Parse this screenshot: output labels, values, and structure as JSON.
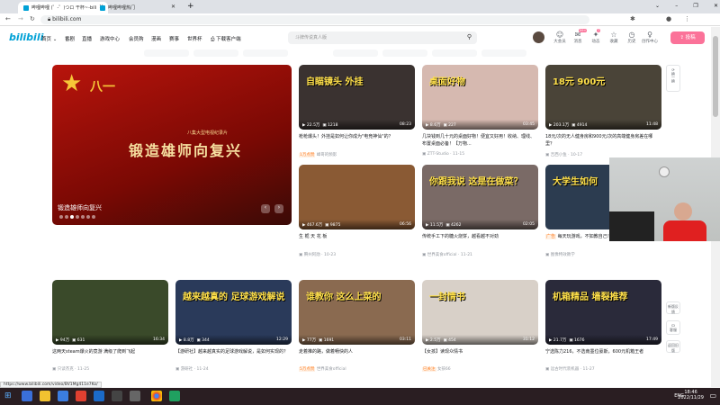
{
  "browser": {
    "tabs": [
      {
        "label": "哔哩哔哩 (゜-゜)つロ 干杯~-bili"
      },
      {
        "label": "哔哩哔哩热门"
      }
    ],
    "new_tab": "+",
    "url": "bilibili.com",
    "window_controls": [
      "⌄",
      "–",
      "❐",
      "✕"
    ]
  },
  "header": {
    "logo": "bilibili",
    "nav": [
      "首页",
      "番剧",
      "直播",
      "游戏中心",
      "会员购",
      "漫画",
      "赛事",
      "世界杯",
      "下载客户端"
    ],
    "search_placeholder": "斗牌传说真人版",
    "icons": [
      {
        "label": "大会员",
        "icon": "☺"
      },
      {
        "label": "消息",
        "icon": "✉",
        "badge": "99+"
      },
      {
        "label": "动态",
        "icon": "✦",
        "badge": "7"
      },
      {
        "label": "收藏",
        "icon": "☆"
      },
      {
        "label": "历史",
        "icon": "◷"
      },
      {
        "label": "创作中心",
        "icon": "♀"
      }
    ],
    "upload": "⇪ 投稿"
  },
  "banner": {
    "headline": "锻造雄师向复兴",
    "badge": "八一",
    "caption": "锻造雄师向复兴",
    "subtitle": "八集大型电视纪录片",
    "slides": 7,
    "active_slide": 2
  },
  "cards": [
    {
      "stats": "22.5万",
      "danmaku": "1218",
      "duration": "08:23",
      "title": "枪枪爆头！外挂是如何让你成为\"电竞神仙\"的？",
      "tag": "1万点赞",
      "author": "峰哥的频影",
      "date": "",
      "overlay": "自瞄镜头 外挂",
      "color": "#3a3230"
    },
    {
      "stats": "8.6万",
      "danmaku": "227",
      "duration": "03:45",
      "title": "几块钱到几十元的桌面好物！便宜又好用！收纳、理线、布置桌面必备！【万物...",
      "tag": "",
      "author": "ZTT-Studio",
      "date": "11-15",
      "overlay": "桌面好物",
      "color": "#d6b9b0"
    },
    {
      "stats": "203.1万",
      "danmaku": "4914",
      "duration": "11:48",
      "title": "18元/次的无人健身房和900元/次的高端健身房差在哪里？",
      "tag": "",
      "author": "吉西小鱼",
      "date": "10-17",
      "overlay": "18元 900元",
      "color": "#4a4438"
    },
    {
      "stats": "467.6万",
      "danmaku": "9875",
      "duration": "06:56",
      "title": "生 栀 天 花 板",
      "tag": "",
      "author": "腾州阿勋",
      "date": "10-23",
      "overlay": "",
      "color": "#8a5a34"
    },
    {
      "stats": "11.5万",
      "danmaku": "4262",
      "duration": "02:05",
      "title": "传统手工下的糖火烧饼，越看越不对劲",
      "tag": "",
      "author": "世界美食official",
      "date": "11-21",
      "overlay": "你跟我说 这是在做菜？",
      "color": "#7a6a66"
    },
    {
      "stats": "",
      "danmaku": "",
      "duration": "",
      "title": "每天玩游戏，不如教自己！",
      "tag": "广告",
      "author": "图像特效教学",
      "date": "",
      "overlay": "大学生如何",
      "color": "#2c3c50"
    },
    {
      "stats": "94万",
      "danmaku": "631",
      "duration": "16:34",
      "title": "这两天steam爆火的竟游 满级了爬到飞起",
      "tag": "",
      "author": "只读杰克",
      "date": "11-25",
      "overlay": "",
      "color": "#3a4a2a"
    },
    {
      "stats": "8.8万",
      "danmaku": "344",
      "duration": "12:29",
      "title": "【游研社】越来越真实的足球游戏解说，是如何实现的？",
      "tag": "",
      "author": "游研社",
      "date": "11-24",
      "overlay": "越来越真的 足球游戏解说",
      "color": "#2a3a5a"
    },
    {
      "stats": "77万",
      "danmaku": "1691",
      "duration": "03:11",
      "title": "走着推的路，做着畅快的人",
      "tag": "5万点赞",
      "author": "世界美食official",
      "date": "",
      "overlay": "谁教你 这么上菜的",
      "color": "#8a6a50"
    },
    {
      "stats": "2.5万",
      "danmaku": "454",
      "duration": "31:12",
      "title": "【女孩】读现众情书",
      "tag": "已关注",
      "author": "女孩66",
      "date": "",
      "overlay": "一封情书",
      "color": "#d8d0c8"
    },
    {
      "stats": "21.7万",
      "danmaku": "1676",
      "duration": "17:49",
      "title": "宁选陈力216，不选南墨位豪斯，600元机箱王者",
      "tag": "",
      "author": "远古时代装机器",
      "date": "11-27",
      "overlay": "机箱精品 墙裂推荐",
      "color": "#2a2a3a"
    }
  ],
  "side_buttons": {
    "refresh": "换一换",
    "feedback": "新版反馈",
    "support": "客服",
    "old": "返回旧版"
  },
  "status_url": "https://www.bilibili.com/video/BV1Mg411e7Ko/",
  "taskbar": {
    "lang": "ENG",
    "time": "18:46",
    "date": "2022/11/29"
  }
}
